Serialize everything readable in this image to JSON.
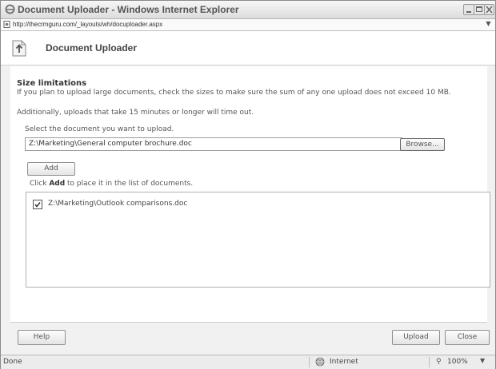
{
  "window": {
    "title": "Document Uploader - Windows Internet Explorer",
    "address": "http://thecrmguru.com/_layouts/wh/docuploader.aspx"
  },
  "header": {
    "title": "Document Uploader"
  },
  "size_limitations": {
    "heading": "Size limitations",
    "text": "If you plan to upload large documents, check the sizes to make sure the sum of any one upload does not exceed 10 MB.",
    "text2": "Additionally, uploads that take 15 minutes or longer will time out."
  },
  "upload_form": {
    "select_label": "Select the document you want to upload.",
    "path_value": "Z:\\Marketing\\General computer brochure.doc",
    "browse_label": "Browse...",
    "add_label": "Add",
    "hint_prefix": "Click ",
    "hint_bold": "Add",
    "hint_suffix": " to place it in the list of documents."
  },
  "documents": [
    {
      "label": "Z:\\Marketing\\Outlook comparisons.doc",
      "checked": true
    }
  ],
  "footer": {
    "help_label": "Help",
    "upload_label": "Upload",
    "close_label": "Close"
  },
  "statusbar": {
    "status": "Done",
    "zone": "Internet",
    "zoom": "100%"
  },
  "icons": {
    "window": "ie-logo-icon",
    "address": "page-icon",
    "header": "document-upload-icon",
    "zone": "globe-icon",
    "zoom": "magnifier-icon"
  }
}
